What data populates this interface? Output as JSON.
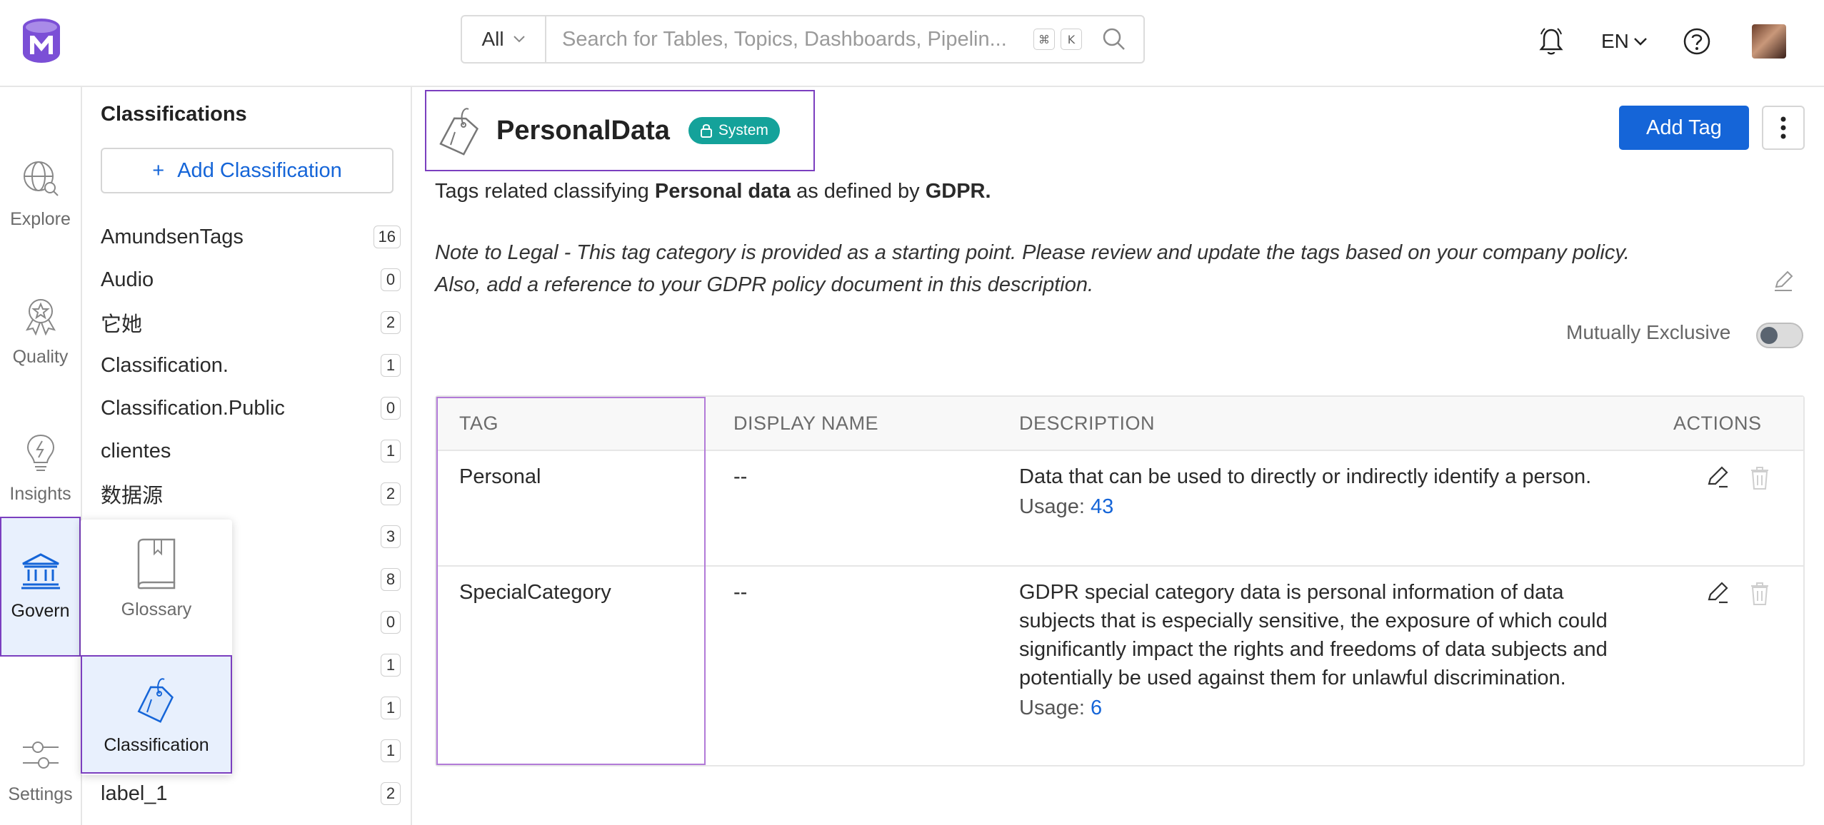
{
  "topbar": {
    "search_filter": "All",
    "search_placeholder": "Search for Tables, Topics, Dashboards, Pipelin...",
    "kbd_cmd": "⌘",
    "kbd_k": "K",
    "language": "EN"
  },
  "leftnav": {
    "items": [
      {
        "label": "Explore"
      },
      {
        "label": "Quality"
      },
      {
        "label": "Insights"
      },
      {
        "label": "Govern"
      },
      {
        "label": "Settings"
      }
    ]
  },
  "govern_menu": {
    "items": [
      {
        "label": "Glossary"
      },
      {
        "label": "Classification"
      }
    ]
  },
  "sidebar": {
    "title": "Classifications",
    "add_button": "Add Classification",
    "add_icon": "+",
    "items": [
      {
        "label": "AmundsenTags",
        "count": "16"
      },
      {
        "label": "Audio",
        "count": "0"
      },
      {
        "label": "它她",
        "count": "2"
      },
      {
        "label": "Classification.",
        "count": "1"
      },
      {
        "label": "Classification.Public",
        "count": "0"
      },
      {
        "label": "clientes",
        "count": "1"
      },
      {
        "label": "数据源",
        "count": "2"
      },
      {
        "label": "",
        "count": "3"
      },
      {
        "label": "",
        "count": "8"
      },
      {
        "label": "",
        "count": "0"
      },
      {
        "label": "",
        "count": "1"
      },
      {
        "label": "",
        "count": "1"
      },
      {
        "label": "",
        "count": "1"
      },
      {
        "label": "label_1",
        "count": "2"
      }
    ]
  },
  "main": {
    "title": "PersonalData",
    "system_badge": "System",
    "add_tag_button": "Add Tag",
    "desc_part1": "Tags related classifying ",
    "desc_bold1": "Personal data",
    "desc_part2": " as defined by ",
    "desc_bold2": "GDPR.",
    "note_line1": "Note to Legal - This tag category is provided as a starting point. Please review and update the tags based on your company policy.",
    "note_line2": "Also, add a reference to your GDPR policy document in this description.",
    "mutually_exclusive_label": "Mutually Exclusive",
    "mutually_exclusive": false
  },
  "table": {
    "headers": {
      "tag": "TAG",
      "display_name": "DISPLAY NAME",
      "description": "DESCRIPTION",
      "actions": "ACTIONS"
    },
    "rows": [
      {
        "tag": "Personal",
        "display_name": "--",
        "description": "Data that can be used to directly or indirectly identify a person.",
        "usage_label": "Usage:",
        "usage": "43"
      },
      {
        "tag": "SpecialCategory",
        "display_name": "--",
        "description": "GDPR special category data is personal information of data subjects that is especially sensitive, the exposure of which could significantly impact the rights and freedoms of data subjects and potentially be used against them for unlawful discrimination.",
        "usage_label": "Usage:",
        "usage": "6"
      }
    ]
  },
  "colors": {
    "primary": "#1565d8",
    "system_badge": "#14a29a",
    "highlight_border": "#7b3fbf",
    "active_bg": "#e8f0fd"
  }
}
